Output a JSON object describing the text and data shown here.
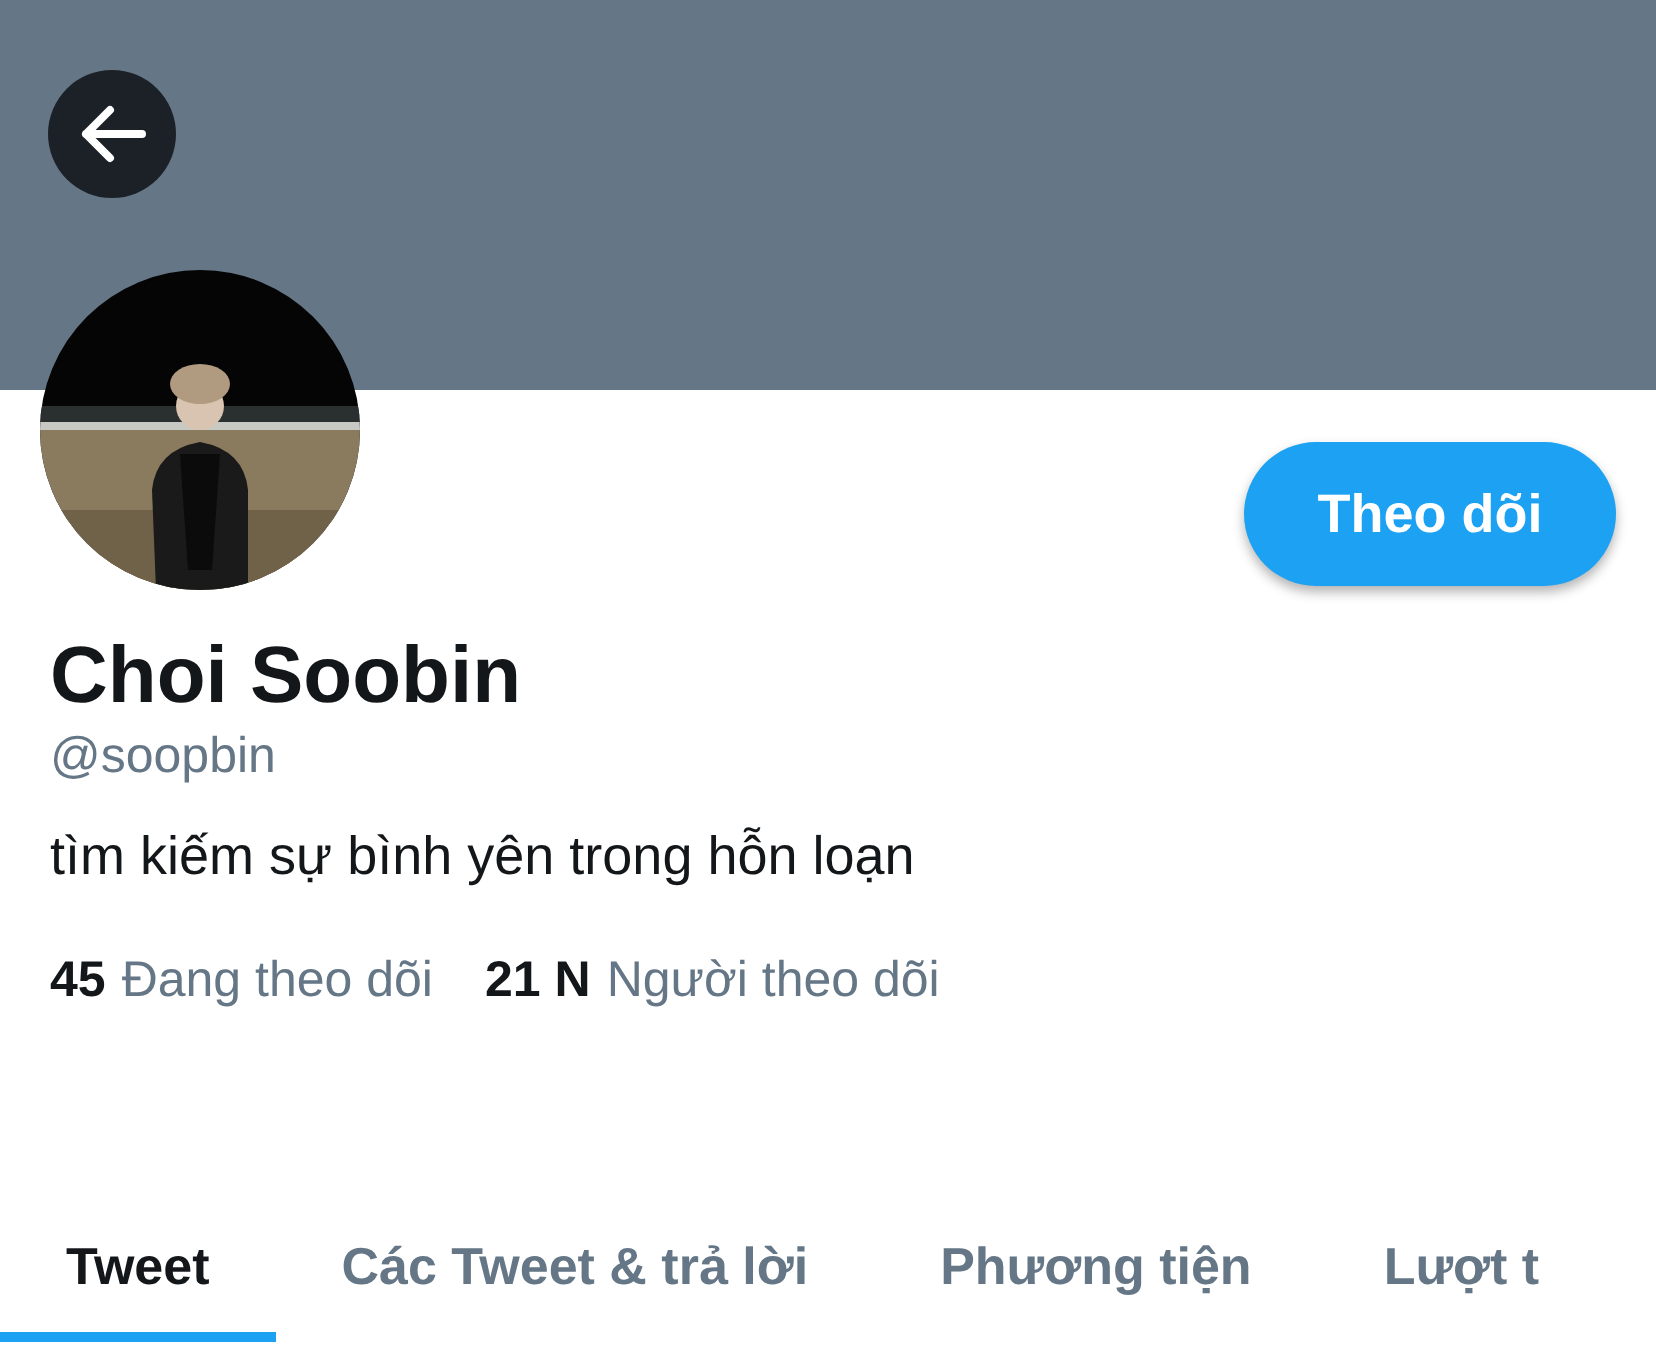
{
  "header": {
    "buttons": [
      {
        "kind": "back"
      }
    ]
  },
  "profile": {
    "follow_button": "Theo dõi",
    "name": "Choi Soobin",
    "handle": "@soopbin",
    "bio": "tìm kiếm sự bình yên trong hỗn loạn",
    "stats": [
      {
        "count": "45",
        "label": "Đang theo dõi"
      },
      {
        "count": "21 N",
        "label": "Người theo dõi"
      }
    ]
  },
  "tabs": [
    {
      "label": "Tweet",
      "selected": true
    },
    {
      "label": "Các Tweet & trả lời",
      "selected": false
    },
    {
      "label": "Phương tiện",
      "selected": false
    },
    {
      "label": "Lượt t",
      "selected": false
    }
  ]
}
